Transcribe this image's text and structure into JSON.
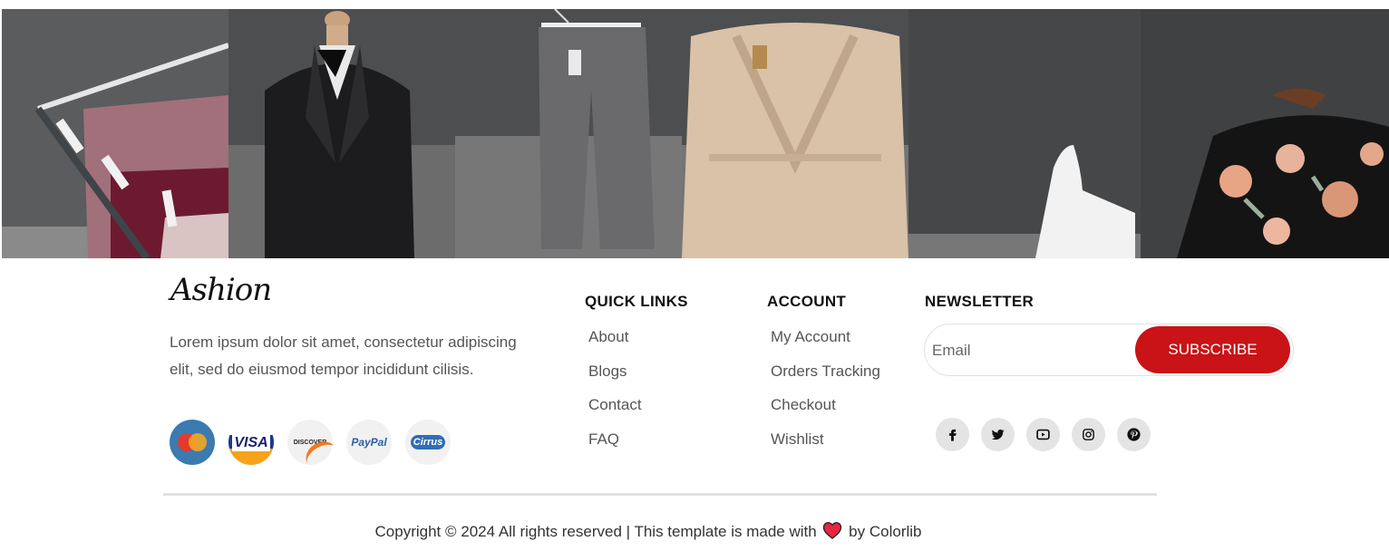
{
  "footer": {
    "logo_text": "Ashion",
    "about": "Lorem ipsum dolor sit amet, consectetur adipiscing elit, sed do eiusmod tempor incididunt cilisis.",
    "payments": [
      {
        "name": "mastercard",
        "label": "MasterCard"
      },
      {
        "name": "visa",
        "label": "VISA"
      },
      {
        "name": "discover",
        "label": "DISCOVER"
      },
      {
        "name": "paypal",
        "label": "PayPal"
      },
      {
        "name": "cirrus",
        "label": "Cirrus"
      }
    ],
    "quick_links": {
      "title": "QUICK LINKS",
      "items": [
        "About",
        "Blogs",
        "Contact",
        "FAQ"
      ]
    },
    "account": {
      "title": "ACCOUNT",
      "items": [
        "My Account",
        "Orders Tracking",
        "Checkout",
        "Wishlist"
      ]
    },
    "newsletter": {
      "title": "NEWSLETTER",
      "placeholder": "Email",
      "button": "SUBSCRIBE"
    },
    "social": [
      "facebook-icon",
      "twitter-icon",
      "youtube-icon",
      "instagram-icon",
      "pinterest-icon"
    ],
    "copyright_before": "Copyright © 2024 All rights reserved | This template is made with",
    "copyright_after": "by Colorlib"
  },
  "colors": {
    "accent": "#c91316",
    "social_bg": "#e4e4e4",
    "divider": "#e2e2e2"
  }
}
